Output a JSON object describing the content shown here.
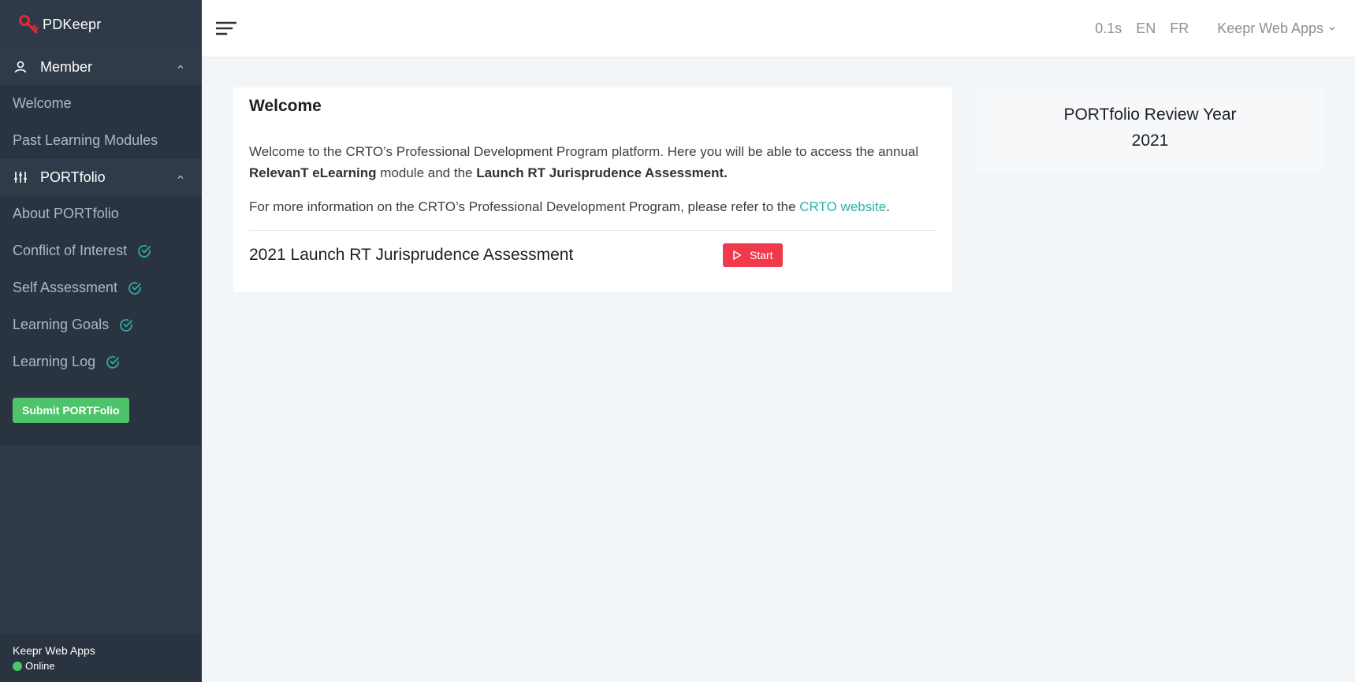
{
  "brand": {
    "name": "PDKeepr"
  },
  "sidebar": {
    "member": {
      "title": "Member",
      "items": [
        {
          "label": "Welcome"
        },
        {
          "label": "Past Learning Modules"
        }
      ]
    },
    "portfolio": {
      "title": "PORTfolio",
      "items": [
        {
          "label": "About PORTfolio"
        },
        {
          "label": "Conflict of Interest"
        },
        {
          "label": "Self Assessment"
        },
        {
          "label": "Learning Goals"
        },
        {
          "label": "Learning Log"
        }
      ]
    },
    "submit_label": "Submit PORTFolio",
    "footer": {
      "app": "Keepr Web Apps",
      "status": "Online"
    }
  },
  "topbar": {
    "timing": "0.1s",
    "lang_en": "EN",
    "lang_fr": "FR",
    "apps_menu": "Keepr Web Apps"
  },
  "main": {
    "title": "Welcome",
    "para1_a": "Welcome to the CRTO’s Professional Development Program platform. Here you will be able to access the annual ",
    "para1_b1": "RelevanT eLearning",
    "para1_c": " module and the ",
    "para1_b2": "Launch RT Jurisprudence Assessment.",
    "para2_a": "For more information on the CRTO’s Professional Development Program, please refer to the ",
    "para2_link": "CRTO website",
    "para2_end": ".",
    "assessment_title": "2021 Launch RT Jurisprudence Assessment",
    "start_label": "Start"
  },
  "side_card": {
    "line1": "PORTfolio Review Year",
    "line2": "2021"
  },
  "colors": {
    "sidebar_bg": "#2f3a49",
    "accent_teal": "#2fb0a8",
    "success_green": "#4ec46a",
    "danger_red": "#f0394d",
    "brand_red": "#e8262f"
  }
}
